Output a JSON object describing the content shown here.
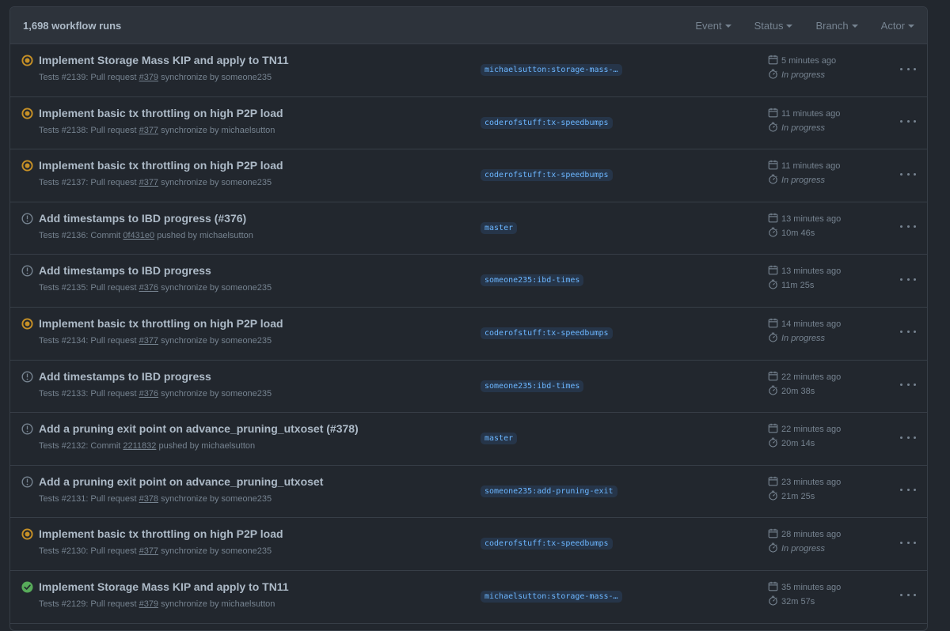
{
  "header": {
    "count": "1,698 workflow runs",
    "filters": [
      "Event",
      "Status",
      "Branch",
      "Actor"
    ]
  },
  "colors": {
    "in_progress": "#c69026",
    "neutral": "#768390",
    "success": "#57ab5a",
    "branch_text": "#6cb6ff"
  },
  "runs": [
    {
      "status": "in-progress",
      "title": "Implement Storage Mass KIP and apply to TN11",
      "prefix": "Tests #2139: Pull request ",
      "ref": "#379",
      "suffix": " synchronize by someone235",
      "branch": "michaelsutton:storage-mass-…",
      "time": "5 minutes ago",
      "duration": "In progress"
    },
    {
      "status": "in-progress",
      "title": "Implement basic tx throttling on high P2P load",
      "prefix": "Tests #2138: Pull request ",
      "ref": "#377",
      "suffix": " synchronize by michaelsutton",
      "branch": "coderofstuff:tx-speedbumps",
      "time": "11 minutes ago",
      "duration": "In progress"
    },
    {
      "status": "in-progress",
      "title": "Implement basic tx throttling on high P2P load",
      "prefix": "Tests #2137: Pull request ",
      "ref": "#377",
      "suffix": " synchronize by someone235",
      "branch": "coderofstuff:tx-speedbumps",
      "time": "11 minutes ago",
      "duration": "In progress"
    },
    {
      "status": "neutral",
      "title": "Add timestamps to IBD progress (#376)",
      "prefix": "Tests #2136: Commit ",
      "ref": "0f431e0",
      "suffix": " pushed by michaelsutton",
      "branch": "master",
      "time": "13 minutes ago",
      "duration": "10m 46s"
    },
    {
      "status": "neutral",
      "title": "Add timestamps to IBD progress",
      "prefix": "Tests #2135: Pull request ",
      "ref": "#376",
      "suffix": " synchronize by someone235",
      "branch": "someone235:ibd-times",
      "time": "13 minutes ago",
      "duration": "11m 25s"
    },
    {
      "status": "in-progress",
      "title": "Implement basic tx throttling on high P2P load",
      "prefix": "Tests #2134: Pull request ",
      "ref": "#377",
      "suffix": " synchronize by someone235",
      "branch": "coderofstuff:tx-speedbumps",
      "time": "14 minutes ago",
      "duration": "In progress"
    },
    {
      "status": "neutral",
      "title": "Add timestamps to IBD progress",
      "prefix": "Tests #2133: Pull request ",
      "ref": "#376",
      "suffix": " synchronize by someone235",
      "branch": "someone235:ibd-times",
      "time": "22 minutes ago",
      "duration": "20m 38s"
    },
    {
      "status": "neutral",
      "title": "Add a pruning exit point on advance_pruning_utxoset (#378)",
      "prefix": "Tests #2132: Commit ",
      "ref": "2211832",
      "suffix": " pushed by michaelsutton",
      "branch": "master",
      "time": "22 minutes ago",
      "duration": "20m 14s"
    },
    {
      "status": "neutral",
      "title": "Add a pruning exit point on advance_pruning_utxoset",
      "prefix": "Tests #2131: Pull request ",
      "ref": "#378",
      "suffix": " synchronize by someone235",
      "branch": "someone235:add-pruning-exit",
      "time": "23 minutes ago",
      "duration": "21m 25s"
    },
    {
      "status": "in-progress",
      "title": "Implement basic tx throttling on high P2P load",
      "prefix": "Tests #2130: Pull request ",
      "ref": "#377",
      "suffix": " synchronize by someone235",
      "branch": "coderofstuff:tx-speedbumps",
      "time": "28 minutes ago",
      "duration": "In progress"
    },
    {
      "status": "success",
      "title": "Implement Storage Mass KIP and apply to TN11",
      "prefix": "Tests #2129: Pull request ",
      "ref": "#379",
      "suffix": " synchronize by michaelsutton",
      "branch": "michaelsutton:storage-mass-…",
      "time": "35 minutes ago",
      "duration": "32m 57s"
    }
  ]
}
